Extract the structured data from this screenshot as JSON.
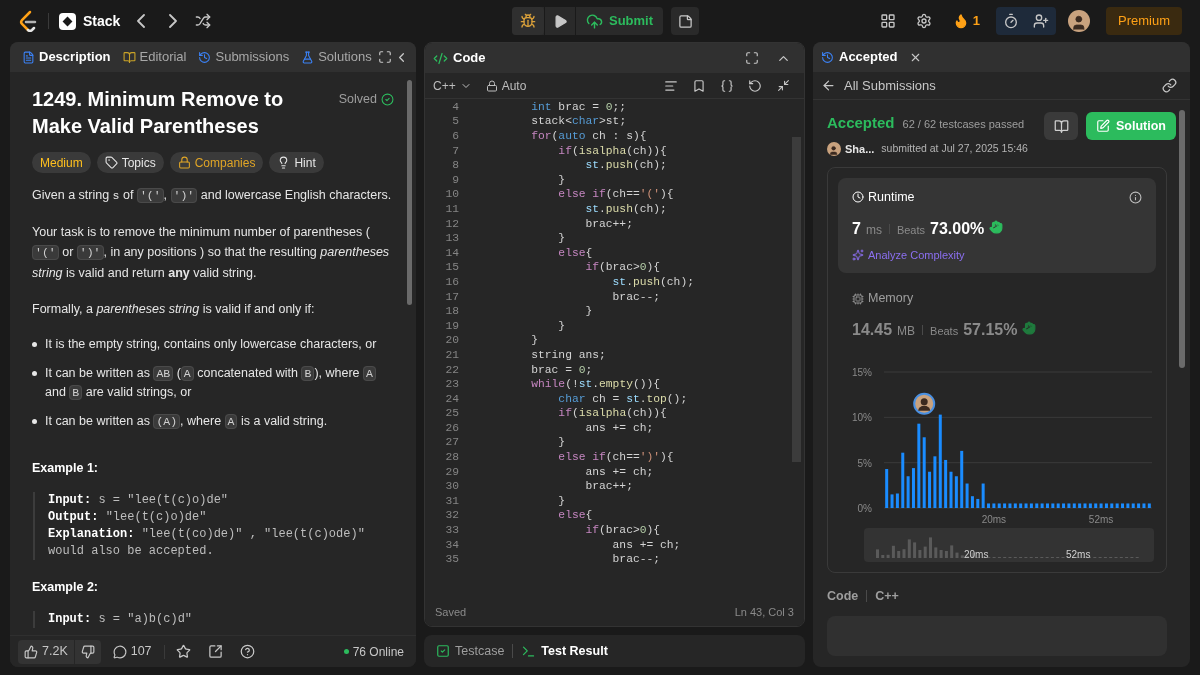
{
  "top_bar": {
    "app_title": "Stack",
    "submit": "Submit",
    "streak": "1",
    "premium": "Premium"
  },
  "description_panel": {
    "tabs": [
      {
        "label": "Description",
        "selected": true
      },
      {
        "label": "Editorial",
        "selected": false
      },
      {
        "label": "Submissions",
        "selected": false
      },
      {
        "label": "Solutions",
        "selected": false
      }
    ],
    "title": "1249. Minimum Remove to Make Valid Parentheses",
    "status": "Solved",
    "difficulty": "Medium",
    "tags": [
      {
        "label": "Topics",
        "kind": "topic"
      },
      {
        "label": "Companies",
        "kind": "company"
      },
      {
        "label": "Hint",
        "kind": "hint"
      }
    ],
    "content": [
      {
        "kind": "paragraph",
        "segments": [
          {
            "text": "Given a string ",
            "kind": "text"
          },
          {
            "text": "s",
            "kind": "var"
          },
          {
            "text": " of ",
            "kind": "text"
          },
          {
            "text": "'('",
            "kind": "code"
          },
          {
            "text": ", ",
            "kind": "text"
          },
          {
            "text": "')'",
            "kind": "code"
          },
          {
            "text": " and lowercase English characters.",
            "kind": "text"
          }
        ]
      },
      {
        "kind": "paragraph",
        "segments": [
          {
            "text": "Your task is to remove the minimum number of parentheses ( ",
            "kind": "text"
          },
          {
            "text": "'('",
            "kind": "code"
          },
          {
            "text": " or ",
            "kind": "text"
          },
          {
            "text": "')'",
            "kind": "code"
          },
          {
            "text": ", in any positions ) so that the resulting *parentheses string* is valid and return **any** valid string.",
            "kind": "text"
          }
        ]
      },
      {
        "kind": "paragraph",
        "segments": [
          {
            "text": "Formally, a *parentheses string* is valid if and only if:",
            "kind": "text"
          }
        ]
      },
      {
        "kind": "bullets",
        "items": [
          [
            {
              "text": "It is the empty string, contains only lowercase characters, or",
              "kind": "text"
            }
          ],
          [
            {
              "text": "It can be written as ",
              "kind": "text"
            },
            {
              "text": "AB",
              "kind": "code"
            },
            {
              "text": " (",
              "kind": "text"
            },
            {
              "text": "A",
              "kind": "code"
            },
            {
              "text": " concatenated with ",
              "kind": "text"
            },
            {
              "text": "B",
              "kind": "code"
            },
            {
              "text": "), where ",
              "kind": "text"
            },
            {
              "text": "A",
              "kind": "code"
            },
            {
              "text": " and ",
              "kind": "text"
            },
            {
              "text": "B",
              "kind": "code"
            },
            {
              "text": " are valid strings, or",
              "kind": "text"
            }
          ],
          [
            {
              "text": "It can be written as ",
              "kind": "text"
            },
            {
              "text": "(A)",
              "kind": "code"
            },
            {
              "text": ", where ",
              "kind": "text"
            },
            {
              "text": "A",
              "kind": "code"
            },
            {
              "text": " is a valid string.",
              "kind": "text"
            }
          ]
        ]
      },
      {
        "kind": "example",
        "title": "Example 1:",
        "lines": [
          {
            "label": "Input:",
            "value": "s = \"lee(t(c)o)de\""
          },
          {
            "label": "Output:",
            "value": "\"lee(t(c)o)de\""
          },
          {
            "label": "Explanation:",
            "value": "\"lee(t(co)de)\" , \"lee(t(c)ode)\""
          },
          {
            "value": "would also be accepted."
          }
        ]
      },
      {
        "kind": "example",
        "title": "Example 2:",
        "lines": [
          {
            "label": "Input:",
            "value": "s = \"a)b(c)d\""
          }
        ]
      }
    ],
    "footer": {
      "likes": "7.2K",
      "comments": "107",
      "online": "76 Online"
    }
  },
  "code_panel": {
    "title": "Code",
    "language": "C++",
    "mode": "Auto",
    "status": "Saved",
    "cursor": "Ln 43, Col 3",
    "lines": [
      {
        "n": "4",
        "tokens": [
          {
            "text": "        int",
            "kind": "type"
          },
          {
            "text": " brac = ",
            "kind": "plain"
          },
          {
            "text": "0",
            "kind": "number"
          },
          {
            "text": ";;",
            "kind": "plain"
          }
        ]
      },
      {
        "n": "5",
        "tokens": [
          {
            "text": "        stack<",
            "kind": "plain"
          },
          {
            "text": "char",
            "kind": "type"
          },
          {
            "text": ">st;",
            "kind": "plain"
          }
        ]
      },
      {
        "n": "6",
        "tokens": [
          {
            "text": "        for",
            "kind": "keyword"
          },
          {
            "text": "(",
            "kind": "plain"
          },
          {
            "text": "auto",
            "kind": "type"
          },
          {
            "text": " ch : s){",
            "kind": "plain"
          }
        ]
      },
      {
        "n": "7",
        "tokens": [
          {
            "text": "            if",
            "kind": "keyword"
          },
          {
            "text": "(",
            "kind": "plain"
          },
          {
            "text": "isalpha",
            "kind": "function"
          },
          {
            "text": "(ch)){",
            "kind": "plain"
          }
        ]
      },
      {
        "n": "8",
        "tokens": [
          {
            "text": "                st",
            "kind": "variable"
          },
          {
            "text": ".",
            "kind": "plain"
          },
          {
            "text": "push",
            "kind": "function"
          },
          {
            "text": "(ch);",
            "kind": "plain"
          }
        ]
      },
      {
        "n": "9",
        "tokens": [
          {
            "text": "            }",
            "kind": "plain"
          }
        ]
      },
      {
        "n": "10",
        "tokens": [
          {
            "text": "            else if",
            "kind": "keyword"
          },
          {
            "text": "(ch==",
            "kind": "plain"
          },
          {
            "text": "'('",
            "kind": "string"
          },
          {
            "text": "){",
            "kind": "plain"
          }
        ]
      },
      {
        "n": "11",
        "tokens": [
          {
            "text": "                st",
            "kind": "variable"
          },
          {
            "text": ".",
            "kind": "plain"
          },
          {
            "text": "push",
            "kind": "function"
          },
          {
            "text": "(ch);",
            "kind": "plain"
          }
        ]
      },
      {
        "n": "12",
        "tokens": [
          {
            "text": "                brac++;",
            "kind": "plain"
          }
        ]
      },
      {
        "n": "13",
        "tokens": [
          {
            "text": "            }",
            "kind": "plain"
          }
        ]
      },
      {
        "n": "14",
        "tokens": [
          {
            "text": "            else",
            "kind": "keyword"
          },
          {
            "text": "{",
            "kind": "plain"
          }
        ]
      },
      {
        "n": "15",
        "tokens": [
          {
            "text": "                if",
            "kind": "keyword"
          },
          {
            "text": "(brac>",
            "kind": "plain"
          },
          {
            "text": "0",
            "kind": "number"
          },
          {
            "text": "){",
            "kind": "plain"
          }
        ]
      },
      {
        "n": "16",
        "tokens": [
          {
            "text": "                    st",
            "kind": "variable"
          },
          {
            "text": ".",
            "kind": "plain"
          },
          {
            "text": "push",
            "kind": "function"
          },
          {
            "text": "(ch);",
            "kind": "plain"
          }
        ]
      },
      {
        "n": "17",
        "tokens": [
          {
            "text": "                    brac--;",
            "kind": "plain"
          }
        ]
      },
      {
        "n": "18",
        "tokens": [
          {
            "text": "                }",
            "kind": "plain"
          }
        ]
      },
      {
        "n": "19",
        "tokens": [
          {
            "text": "            }",
            "kind": "plain"
          }
        ]
      },
      {
        "n": "20",
        "tokens": [
          {
            "text": "        }",
            "kind": "plain"
          }
        ]
      },
      {
        "n": "21",
        "tokens": [
          {
            "text": "        string ans;",
            "kind": "plain"
          }
        ]
      },
      {
        "n": "22",
        "tokens": [
          {
            "text": "        brac = ",
            "kind": "plain"
          },
          {
            "text": "0",
            "kind": "number"
          },
          {
            "text": ";",
            "kind": "plain"
          }
        ]
      },
      {
        "n": "23",
        "tokens": [
          {
            "text": "        while",
            "kind": "keyword"
          },
          {
            "text": "(!",
            "kind": "plain"
          },
          {
            "text": "st",
            "kind": "variable"
          },
          {
            "text": ".",
            "kind": "plain"
          },
          {
            "text": "empty",
            "kind": "function"
          },
          {
            "text": "()){",
            "kind": "plain"
          }
        ]
      },
      {
        "n": "24",
        "tokens": [
          {
            "text": "            char",
            "kind": "type"
          },
          {
            "text": " ch = ",
            "kind": "plain"
          },
          {
            "text": "st",
            "kind": "variable"
          },
          {
            "text": ".",
            "kind": "plain"
          },
          {
            "text": "top",
            "kind": "function"
          },
          {
            "text": "();",
            "kind": "plain"
          }
        ]
      },
      {
        "n": "25",
        "tokens": [
          {
            "text": "            if",
            "kind": "keyword"
          },
          {
            "text": "(",
            "kind": "plain"
          },
          {
            "text": "isalpha",
            "kind": "function"
          },
          {
            "text": "(ch)){",
            "kind": "plain"
          }
        ]
      },
      {
        "n": "26",
        "tokens": [
          {
            "text": "                ans += ch;",
            "kind": "plain"
          }
        ]
      },
      {
        "n": "27",
        "tokens": [
          {
            "text": "            }",
            "kind": "plain"
          }
        ]
      },
      {
        "n": "28",
        "tokens": [
          {
            "text": "            else if",
            "kind": "keyword"
          },
          {
            "text": "(ch==",
            "kind": "plain"
          },
          {
            "text": "')'",
            "kind": "string"
          },
          {
            "text": "){",
            "kind": "plain"
          }
        ]
      },
      {
        "n": "29",
        "tokens": [
          {
            "text": "                ans += ch;",
            "kind": "plain"
          }
        ]
      },
      {
        "n": "30",
        "tokens": [
          {
            "text": "                brac++;",
            "kind": "plain"
          }
        ]
      },
      {
        "n": "31",
        "tokens": [
          {
            "text": "            }",
            "kind": "plain"
          }
        ]
      },
      {
        "n": "32",
        "tokens": [
          {
            "text": "            else",
            "kind": "keyword"
          },
          {
            "text": "{",
            "kind": "plain"
          }
        ]
      },
      {
        "n": "33",
        "tokens": [
          {
            "text": "                if",
            "kind": "keyword"
          },
          {
            "text": "(brac>",
            "kind": "plain"
          },
          {
            "text": "0",
            "kind": "number"
          },
          {
            "text": "){",
            "kind": "plain"
          }
        ]
      },
      {
        "n": "34",
        "tokens": [
          {
            "text": "                    ans += ch;",
            "kind": "plain"
          }
        ]
      },
      {
        "n": "35",
        "tokens": [
          {
            "text": "                    brac--;",
            "kind": "plain"
          }
        ]
      }
    ]
  },
  "bottom_tabs": [
    {
      "label": "Testcase",
      "selected": false
    },
    {
      "label": "Test Result",
      "selected": true
    }
  ],
  "result_panel": {
    "tab": "Accepted",
    "back_link": "All Submissions",
    "verdict": "Accepted",
    "testcases": "62 / 62 testcases passed",
    "user": "Sha...",
    "submitted": "submitted at Jul 27, 2025 15:46",
    "solution_button": "Solution",
    "metrics": [
      {
        "title": "Runtime",
        "value": "7",
        "unit": "ms",
        "beats_label": "Beats",
        "beats": "73.00%",
        "selected": true,
        "action": "Analyze Complexity"
      },
      {
        "title": "Memory",
        "value": "14.45",
        "unit": "MB",
        "beats_label": "Beats",
        "beats": "57.15%",
        "selected": false
      }
    ],
    "chart_data": {
      "type": "bar",
      "ylim": [
        0,
        15
      ],
      "yticks": [
        {
          "value": 0,
          "label": "0%"
        },
        {
          "value": 5,
          "label": "5%"
        },
        {
          "value": 10,
          "label": "10%"
        },
        {
          "value": 15,
          "label": "15%"
        }
      ],
      "categories": [
        null,
        null,
        null,
        null,
        null,
        null,
        null,
        null,
        null,
        null,
        null,
        null,
        null,
        null,
        null,
        null,
        null,
        null,
        null,
        null,
        "20ms",
        null,
        null,
        null,
        null,
        null,
        null,
        null,
        null,
        null,
        null,
        null,
        null,
        null,
        null,
        null,
        null,
        null,
        null,
        null,
        "52ms",
        null,
        null,
        null,
        null,
        null,
        null,
        null,
        null,
        null
      ],
      "values": [
        4.3,
        1.5,
        1.6,
        6.1,
        3.5,
        4.4,
        9.3,
        7.8,
        4.0,
        5.7,
        10.3,
        5.3,
        4.0,
        3.5,
        6.3,
        2.7,
        1.3,
        1.0,
        2.7,
        0.5,
        0.5,
        0.5,
        0.5,
        0.5,
        0.5,
        0.5,
        0.5,
        0.5,
        0.5,
        0.5,
        0.5,
        0.5,
        0.5,
        0.5,
        0.5,
        0.5,
        0.5,
        0.5,
        0.5,
        0.5,
        0.5,
        0.5,
        0.5,
        0.5,
        0.5,
        0.5,
        0.5,
        0.5,
        0.5,
        0.5
      ]
    },
    "overview_labels": [
      "20ms",
      "52ms"
    ],
    "code_label": "Code",
    "code_language": "C++"
  }
}
